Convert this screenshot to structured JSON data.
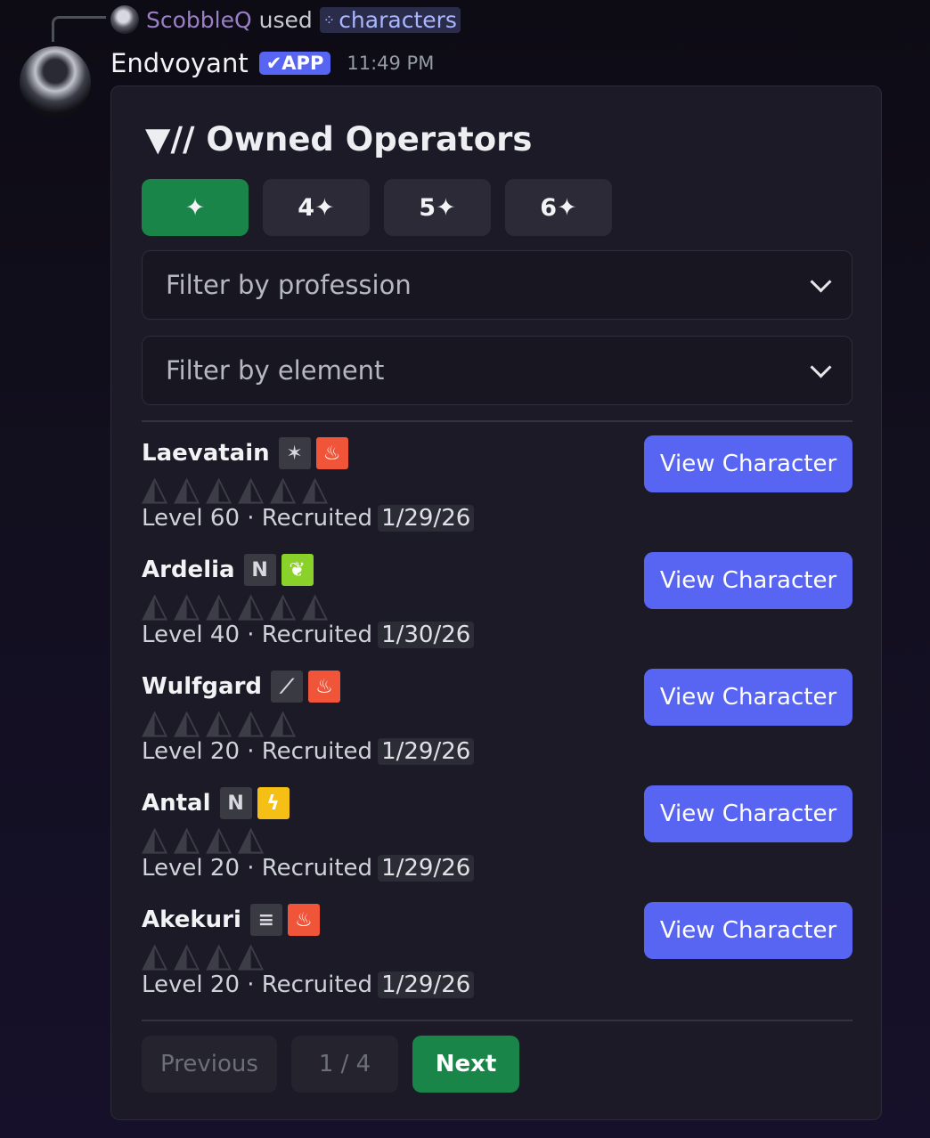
{
  "reply": {
    "user": "ScobbleQ",
    "used": "used",
    "command": "characters",
    "command_icon": "app-command-icon"
  },
  "message": {
    "bot_name": "Endvoyant",
    "badge": "✔APP",
    "timestamp": "11:49 PM"
  },
  "embed": {
    "title": "▼// Owned Operators",
    "star_filters": [
      "✦",
      "4✦",
      "5✦",
      "6✦"
    ],
    "active_star_filter": 0,
    "profession_placeholder": "Filter by profession",
    "element_placeholder": "Filter by element",
    "view_button_label": "View Character",
    "operators": [
      {
        "name": "Laevatain",
        "class_icon": "striker-icon",
        "element": "heat-icon",
        "rarity": 6,
        "level_text": "Level 60 · Recruited",
        "date": "1/29/26"
      },
      {
        "name": "Ardelia",
        "class_icon": "supporter-icon",
        "element": "nature-icon",
        "rarity": 6,
        "level_text": "Level 40 · Recruited",
        "date": "1/30/26"
      },
      {
        "name": "Wulfgard",
        "class_icon": "caster-icon",
        "element": "heat-icon",
        "rarity": 5,
        "level_text": "Level 20 · Recruited",
        "date": "1/29/26"
      },
      {
        "name": "Antal",
        "class_icon": "supporter-icon",
        "element": "electric-icon",
        "rarity": 4,
        "level_text": "Level 20 · Recruited",
        "date": "1/29/26"
      },
      {
        "name": "Akekuri",
        "class_icon": "vanguard-icon",
        "element": "heat-icon",
        "rarity": 4,
        "level_text": "Level 20 · Recruited",
        "date": "1/29/26"
      }
    ],
    "pagination": {
      "previous": "Previous",
      "page": "1 / 4",
      "next": "Next"
    }
  },
  "colors": {
    "accent": "#5865f2",
    "success": "#1a8549",
    "heat": "#f0553a",
    "nature": "#8ad22a",
    "electric": "#f5bf16"
  }
}
